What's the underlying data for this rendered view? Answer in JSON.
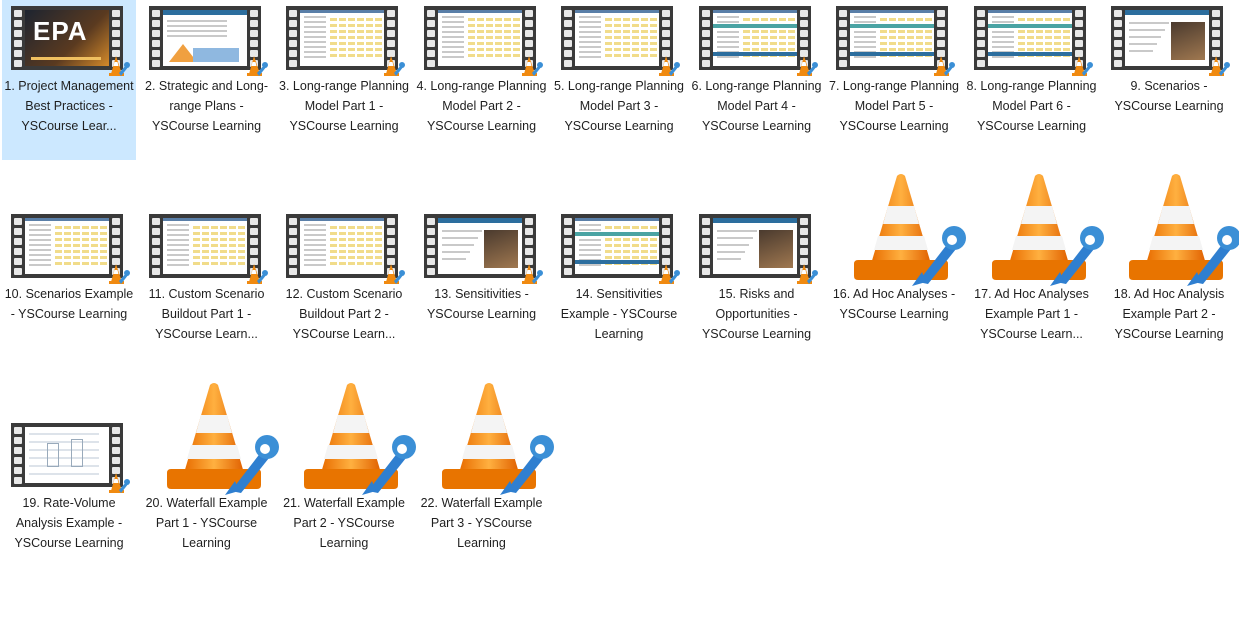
{
  "window": {
    "view": "Large icons"
  },
  "files": [
    {
      "label": "1. Project Management Best Practices - YSCourse Lear...",
      "thumb": "video-intro",
      "selected": true
    },
    {
      "label": "2. Strategic and Long-range Plans - YSCourse Learning",
      "thumb": "video-chart"
    },
    {
      "label": "3. Long-range Planning Model Part 1 - YSCourse Learning",
      "thumb": "video-sheet"
    },
    {
      "label": "4. Long-range Planning Model Part 2 - YSCourse Learning",
      "thumb": "video-sheet"
    },
    {
      "label": "5. Long-range Planning Model Part 3 - YSCourse Learning",
      "thumb": "video-sheet"
    },
    {
      "label": "6. Long-range Planning Model Part 4 - YSCourse Learning",
      "thumb": "video-teal"
    },
    {
      "label": "7. Long-range Planning Model Part 5 - YSCourse Learning",
      "thumb": "video-teal"
    },
    {
      "label": "8. Long-range Planning Model Part 6 - YSCourse Learning",
      "thumb": "video-teal"
    },
    {
      "label": "9. Scenarios - YSCourse Learning",
      "thumb": "video-photo"
    },
    {
      "label": "10. Scenarios Example - YSCourse Learning",
      "thumb": "video-sheet"
    },
    {
      "label": "11. Custom Scenario Buildout Part 1 - YSCourse Learn...",
      "thumb": "video-sheet"
    },
    {
      "label": "12. Custom Scenario Buildout Part 2 - YSCourse Learn...",
      "thumb": "video-sheet"
    },
    {
      "label": "13. Sensitivities - YSCourse Learning",
      "thumb": "video-photo"
    },
    {
      "label": "14. Sensitivities Example - YSCourse Learning",
      "thumb": "video-teal"
    },
    {
      "label": "15. Risks and Opportunities - YSCourse Learning",
      "thumb": "video-photo"
    },
    {
      "label": "16. Ad Hoc Analyses - YSCourse Learning",
      "thumb": "vlc-cone"
    },
    {
      "label": "17. Ad Hoc Analyses Example Part 1 - YSCourse Learn...",
      "thumb": "vlc-cone"
    },
    {
      "label": "18. Ad Hoc Analysis Example Part 2 - YSCourse Learning",
      "thumb": "vlc-cone"
    },
    {
      "label": "19. Rate-Volume Analysis Example - YSCourse Learning",
      "thumb": "video-light"
    },
    {
      "label": "20. Waterfall Example Part 1 - YSCourse Learning",
      "thumb": "vlc-cone"
    },
    {
      "label": "21. Waterfall Example Part 2 - YSCourse Learning",
      "thumb": "vlc-cone"
    },
    {
      "label": "22. Waterfall Example Part 3 - YSCourse Learning",
      "thumb": "vlc-cone"
    }
  ],
  "colors": {
    "selection": "#cce8ff",
    "vlc_orange": "#f08a10",
    "vlc_blue": "#3b8fd6"
  }
}
